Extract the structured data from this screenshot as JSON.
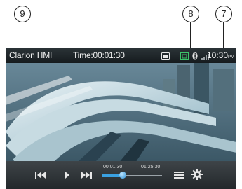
{
  "callouts": [
    "9",
    "8",
    "7"
  ],
  "status_bar": {
    "app_name": "Clarion HMI",
    "elapsed_label": "Time:00:01:30",
    "clock": "10:30",
    "clock_suffix": "PM"
  },
  "playback": {
    "current_time": "00:01:30",
    "total_time": "01:25:30",
    "progress_fraction": 0.35
  },
  "icons": [
    "media-icon",
    "screen-mode-icon",
    "bluetooth-icon",
    "signal-icon",
    "previous-track-icon",
    "play-icon",
    "next-track-icon",
    "list-icon",
    "settings-gear-icon"
  ],
  "colors": {
    "accent": "#3aa0e0"
  }
}
